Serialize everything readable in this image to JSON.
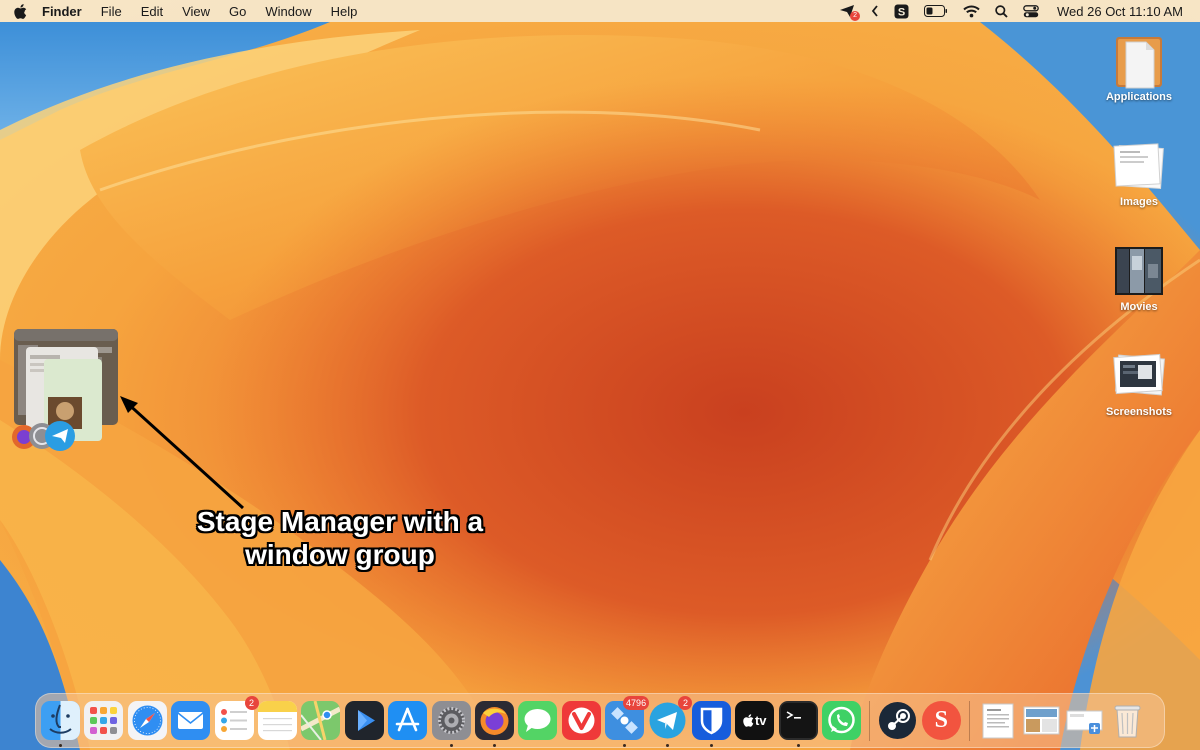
{
  "menubar": {
    "app_name": "Finder",
    "menus": [
      "File",
      "Edit",
      "View",
      "Go",
      "Window",
      "Help"
    ],
    "status": {
      "notification_badge": "2",
      "clock": "Wed 26 Oct  11:10 AM"
    }
  },
  "desktop_icons": [
    {
      "label": "Applications",
      "icon": "folder-document-icon"
    },
    {
      "label": "Images",
      "icon": "image-stack-icon"
    },
    {
      "label": "Movies",
      "icon": "movie-stack-icon"
    },
    {
      "label": "Screenshots",
      "icon": "screenshot-stack-icon"
    }
  ],
  "annotation": {
    "line1": "Stage Manager with a",
    "line2": "window group"
  },
  "dock": {
    "apps": [
      {
        "name": "Finder",
        "icon": "finder-icon",
        "running": true,
        "badge": ""
      },
      {
        "name": "Launchpad",
        "icon": "launchpad-icon",
        "running": false,
        "badge": ""
      },
      {
        "name": "Safari",
        "icon": "safari-icon",
        "running": false,
        "badge": ""
      },
      {
        "name": "Mail",
        "icon": "mail-icon",
        "running": false,
        "badge": ""
      },
      {
        "name": "Reminders",
        "icon": "reminders-icon",
        "running": false,
        "badge": "2"
      },
      {
        "name": "Notes",
        "icon": "notes-icon",
        "running": false,
        "badge": ""
      },
      {
        "name": "Maps",
        "icon": "maps-icon",
        "running": false,
        "badge": ""
      },
      {
        "name": "Infuse",
        "icon": "play-icon",
        "running": false,
        "badge": ""
      },
      {
        "name": "App Store",
        "icon": "app-store-icon",
        "running": false,
        "badge": ""
      },
      {
        "name": "System Settings",
        "icon": "gear-icon",
        "running": true,
        "badge": ""
      },
      {
        "name": "Firefox",
        "icon": "firefox-icon",
        "running": true,
        "badge": ""
      },
      {
        "name": "Messages",
        "icon": "messages-icon",
        "running": false,
        "badge": ""
      },
      {
        "name": "Vivaldi",
        "icon": "vivaldi-icon",
        "running": false,
        "badge": ""
      },
      {
        "name": "NetNewsWire",
        "icon": "satellite-icon",
        "running": true,
        "badge": "4796"
      },
      {
        "name": "Telegram",
        "icon": "telegram-icon",
        "running": true,
        "badge": "2"
      },
      {
        "name": "Bitwarden",
        "icon": "shield-icon",
        "running": true,
        "badge": ""
      },
      {
        "name": "TV",
        "icon": "apple-tv-icon",
        "running": false,
        "badge": ""
      },
      {
        "name": "Terminal",
        "icon": "terminal-icon",
        "running": true,
        "badge": ""
      },
      {
        "name": "WhatsApp",
        "icon": "whatsapp-icon",
        "running": false,
        "badge": ""
      },
      {
        "name": "Steam",
        "icon": "steam-icon",
        "running": false,
        "badge": ""
      },
      {
        "name": "Setapp",
        "icon": "setapp-icon",
        "running": false,
        "badge": ""
      }
    ],
    "tv_label": "tv",
    "setapp_letter": "S",
    "stacks": [
      {
        "name": "Documents stack",
        "icon": "document-stack-icon"
      },
      {
        "name": "Downloads stack",
        "icon": "downloads-stack-icon"
      },
      {
        "name": "Screenshot stack",
        "icon": "screenshot-file-icon"
      }
    ],
    "trash": {
      "name": "Trash",
      "icon": "trash-icon"
    }
  }
}
